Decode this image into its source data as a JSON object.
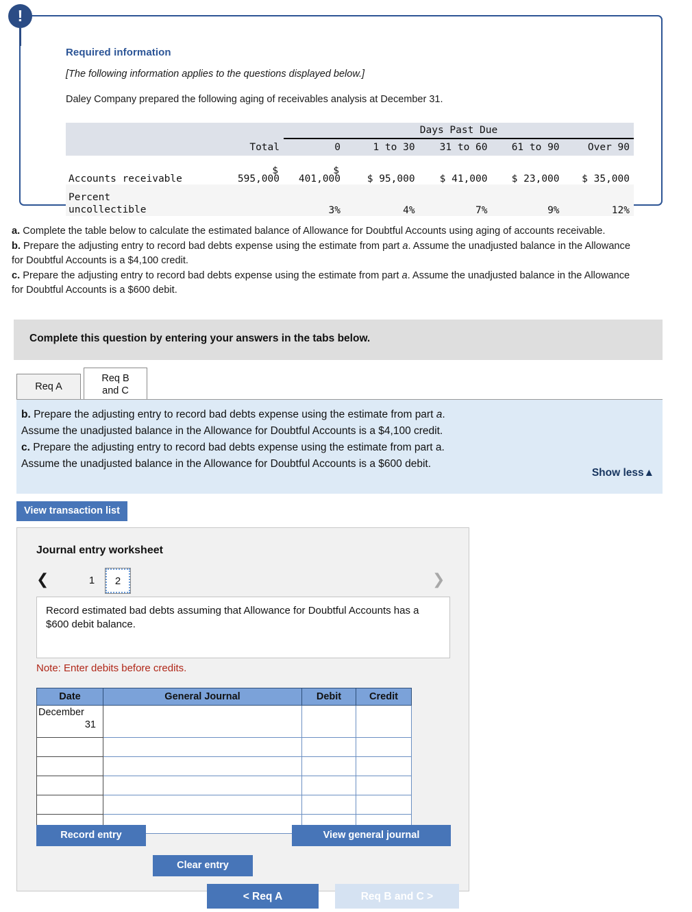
{
  "required_info": {
    "bullet_icon": "exclamation-icon",
    "heading": "Required information",
    "applies_note": "[The following information applies to the questions displayed below.]",
    "lead": "Daley Company prepared the following aging of receivables analysis at December 31."
  },
  "aging_table": {
    "span_header": "Days Past Due",
    "row_label_header": "",
    "columns": [
      "Total",
      "0",
      "1 to 30",
      "31 to 60",
      "61 to 90",
      "Over 90"
    ],
    "rows": [
      {
        "label": "Accounts receivable",
        "values": [
          {
            "currency": "$",
            "amount": "595,000"
          },
          {
            "currency": "$",
            "amount": "401,000"
          },
          {
            "currency": "$",
            "amount": "95,000"
          },
          {
            "currency": "$",
            "amount": "41,000"
          },
          {
            "currency": "$",
            "amount": "23,000"
          },
          {
            "currency": "$",
            "amount": "35,000"
          }
        ]
      },
      {
        "label_line1": "Percent",
        "label_line2": "uncollectible",
        "values": [
          "",
          "3%",
          "4%",
          "7%",
          "9%",
          "12%"
        ]
      }
    ]
  },
  "requirements": {
    "a_label": "a.",
    "a_text": " Complete the table below to calculate the estimated balance of Allowance for Doubtful Accounts using aging of accounts receivable.",
    "b_label": "b.",
    "b_text_1": " Prepare the adjusting entry to record bad debts expense using the estimate from part ",
    "b_italic": "a",
    "b_text_2": ". Assume the unadjusted balance in the Allowance for Doubtful Accounts is a $4,100 credit.",
    "c_label": "c.",
    "c_text_1": " Prepare the adjusting entry to record bad debts expense using the estimate from part ",
    "c_italic": "a",
    "c_text_2": ". Assume the unadjusted balance in the Allowance for Doubtful Accounts is a $600 debit."
  },
  "banner": {
    "text": "Complete this question by entering your answers in the tabs below."
  },
  "tabs": {
    "items": [
      {
        "label": "Req A",
        "active": false
      },
      {
        "label_line1": "Req B",
        "label_line2": "and C",
        "active": true
      }
    ]
  },
  "instruction_panel": {
    "line1_label": "b.",
    "line1": " Prepare the adjusting entry to record bad debts expense using the estimate from part ",
    "line1_italic": "a",
    "line1_end": ".",
    "line2": "Assume the unadjusted balance in the Allowance for Doubtful Accounts is a $4,100 credit.",
    "line3_label": "c.",
    "line3": " Prepare the adjusting entry to record bad debts expense using the estimate from part a.",
    "line4": "Assume the unadjusted balance in the Allowance for Doubtful Accounts is a $600 debit.",
    "show_less": "Show less▲"
  },
  "view_transaction_list_label": "View transaction list",
  "worksheet": {
    "title": "Journal entry worksheet",
    "pager": {
      "prev_icon": "chevron-left-icon",
      "next_icon": "chevron-right-icon",
      "pages": [
        "1",
        "2"
      ],
      "selected": "2"
    },
    "prompt": "Record estimated bad debts assuming that Allowance for Doubtful Accounts has a $600 debit balance.",
    "note": "Note: Enter debits before credits.",
    "table": {
      "headers": [
        "Date",
        "General Journal",
        "Debit",
        "Credit"
      ],
      "rows": [
        {
          "date_line1": "December",
          "date_line2": "31",
          "general_journal": "",
          "debit": "",
          "credit": ""
        },
        {
          "date_line1": "",
          "date_line2": "",
          "general_journal": "",
          "debit": "",
          "credit": ""
        },
        {
          "date_line1": "",
          "date_line2": "",
          "general_journal": "",
          "debit": "",
          "credit": ""
        },
        {
          "date_line1": "",
          "date_line2": "",
          "general_journal": "",
          "debit": "",
          "credit": ""
        },
        {
          "date_line1": "",
          "date_line2": "",
          "general_journal": "",
          "debit": "",
          "credit": ""
        },
        {
          "date_line1": "",
          "date_line2": "",
          "general_journal": "",
          "debit": "",
          "credit": ""
        }
      ]
    },
    "buttons": {
      "record_entry": "Record entry",
      "clear_entry": "Clear entry",
      "view_general_journal": "View general journal"
    }
  },
  "bottom_nav": {
    "prev_label": "< Req A",
    "next_label": "Req B and C  >"
  },
  "colors": {
    "accent_blue": "#2d5494",
    "button_blue": "#4775b8",
    "panel_blue": "#ddeaf6",
    "table_header_blue": "#7ba2d9",
    "note_red": "#b02718",
    "banner_grey": "#dedede"
  }
}
